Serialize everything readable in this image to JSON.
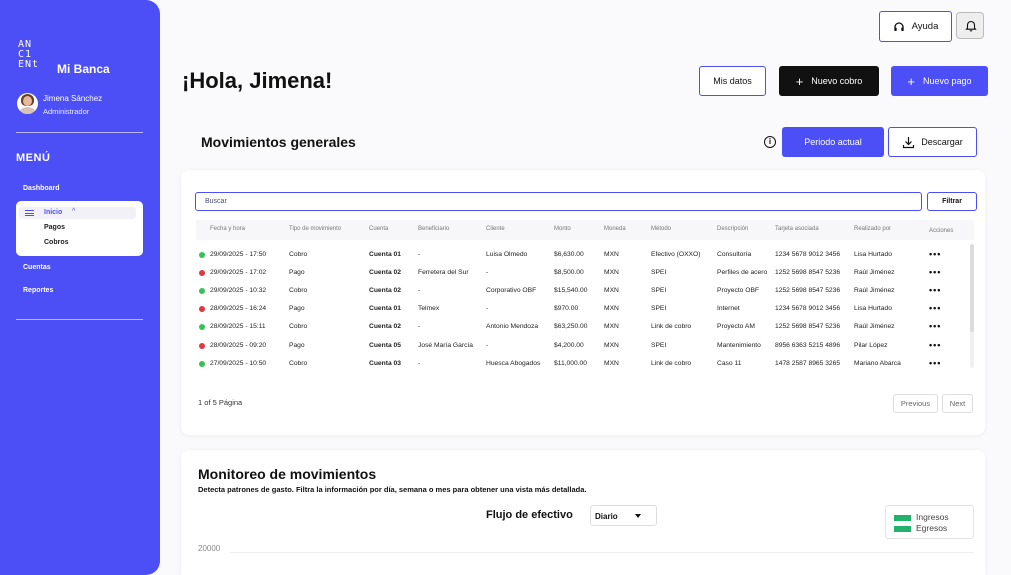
{
  "sidebar": {
    "logo": [
      "AN",
      "C1",
      "ENt"
    ],
    "brand": "Mi Banca",
    "user_name": "Jimena Sánchez",
    "user_role": "Administrador",
    "menu_heading": "MENÚ",
    "items": {
      "dashboard": "Dashboard",
      "inicio": "Inicio",
      "pagos": "Pagos",
      "cobros": "Cobros",
      "cuentas": "Cuentas",
      "reportes": "Reportes"
    }
  },
  "header": {
    "help_label": "Ayuda",
    "greeting": "¡Hola, Jimena!",
    "mis_datos": "Mis datos",
    "nuevo_cobro": "Nuevo cobro",
    "nuevo_pago": "Nuevo pago"
  },
  "movimientos": {
    "title": "Movimientos generales",
    "periodo": "Periodo actual",
    "descargar": "Descargar",
    "search_placeholder": "Buscar",
    "filtrar": "Filtrar",
    "columns": [
      "Fecha y hora",
      "Tipo de movimiento",
      "Cuenta",
      "Beneficiario",
      "Cliente",
      "Monto",
      "Moneda",
      "Método",
      "Descripción",
      "Tarjeta asociada",
      "Realizado por",
      "Acciones"
    ],
    "rows": [
      {
        "status": "green",
        "fecha": "29/09/2025 - 17:50",
        "tipo": "Cobro",
        "cuenta": "Cuenta 01",
        "beneficiario": "-",
        "cliente": "Luisa Olmedo",
        "monto": "$6,630.00",
        "moneda": "MXN",
        "metodo": "Efectivo (OXXO)",
        "descripcion": "Consultoría",
        "tarjeta": "1234 5678 9012 3456",
        "realizado": "Lisa Hurtado"
      },
      {
        "status": "red",
        "fecha": "29/09/2025 - 17:02",
        "tipo": "Pago",
        "cuenta": "Cuenta 02",
        "beneficiario": "Ferretera del Sur",
        "cliente": "-",
        "monto": "$8,500.00",
        "moneda": "MXN",
        "metodo": "SPEI",
        "descripcion": "Perfiles de acero",
        "tarjeta": "1252 5698 8547 5236",
        "realizado": "Raúl Jiménez"
      },
      {
        "status": "green",
        "fecha": "29/09/2025 - 10:32",
        "tipo": "Cobro",
        "cuenta": "Cuenta 02",
        "beneficiario": "-",
        "cliente": "Corporativo OBF",
        "monto": "$15,540.00",
        "moneda": "MXN",
        "metodo": "SPEI",
        "descripcion": "Proyecto OBF",
        "tarjeta": "1252 5698 8547 5236",
        "realizado": "Raúl Jiménez"
      },
      {
        "status": "red",
        "fecha": "28/09/2025 - 16:24",
        "tipo": "Pago",
        "cuenta": "Cuenta 01",
        "beneficiario": "Telmex",
        "cliente": "-",
        "monto": "$970.00",
        "moneda": "MXN",
        "metodo": "SPEI",
        "descripcion": "Internet",
        "tarjeta": "1234 5678 9012 3456",
        "realizado": "Lisa Hurtado"
      },
      {
        "status": "green",
        "fecha": "28/09/2025 - 15:11",
        "tipo": "Cobro",
        "cuenta": "Cuenta 02",
        "beneficiario": "-",
        "cliente": "Antonio Mendoza",
        "monto": "$63,250.00",
        "moneda": "MXN",
        "metodo": "Link de cobro",
        "descripcion": "Proyecto AM",
        "tarjeta": "1252 5698 8547 5236",
        "realizado": "Raúl Jiménez"
      },
      {
        "status": "red",
        "fecha": "28/09/2025 - 09:20",
        "tipo": "Pago",
        "cuenta": "Cuenta 05",
        "beneficiario": "José María García",
        "cliente": "-",
        "monto": "$4,200.00",
        "moneda": "MXN",
        "metodo": "SPEI",
        "descripcion": "Mantenimiento",
        "tarjeta": "8956 6363 5215 4896",
        "realizado": "Pilar López"
      },
      {
        "status": "green",
        "fecha": "27/09/2025 - 10:50",
        "tipo": "Cobro",
        "cuenta": "Cuenta 03",
        "beneficiario": "-",
        "cliente": "Huesca Abogados",
        "monto": "$11,000.00",
        "moneda": "MXN",
        "metodo": "Link de cobro",
        "descripcion": "Caso 11",
        "tarjeta": "1478 2587 8965 3265",
        "realizado": "Mariano Abarca"
      }
    ],
    "actions_label": "•••",
    "pagination": "1 of 5 Página",
    "previous": "Previous",
    "next": "Next"
  },
  "colors": {
    "green": "#35c25a",
    "red": "#e0383d",
    "accent": "#4b4ff5"
  },
  "monitoreo": {
    "title": "Monitoreo de movimientos",
    "description": "Detecta patrones de gasto. Filtra la información por día, semana o mes para obtener una vista más detallada.",
    "chart_title": "Flujo de efectivo",
    "period_select": "Diario",
    "legend": [
      "Ingresos",
      "Egresos"
    ],
    "y_tick": "20000"
  }
}
